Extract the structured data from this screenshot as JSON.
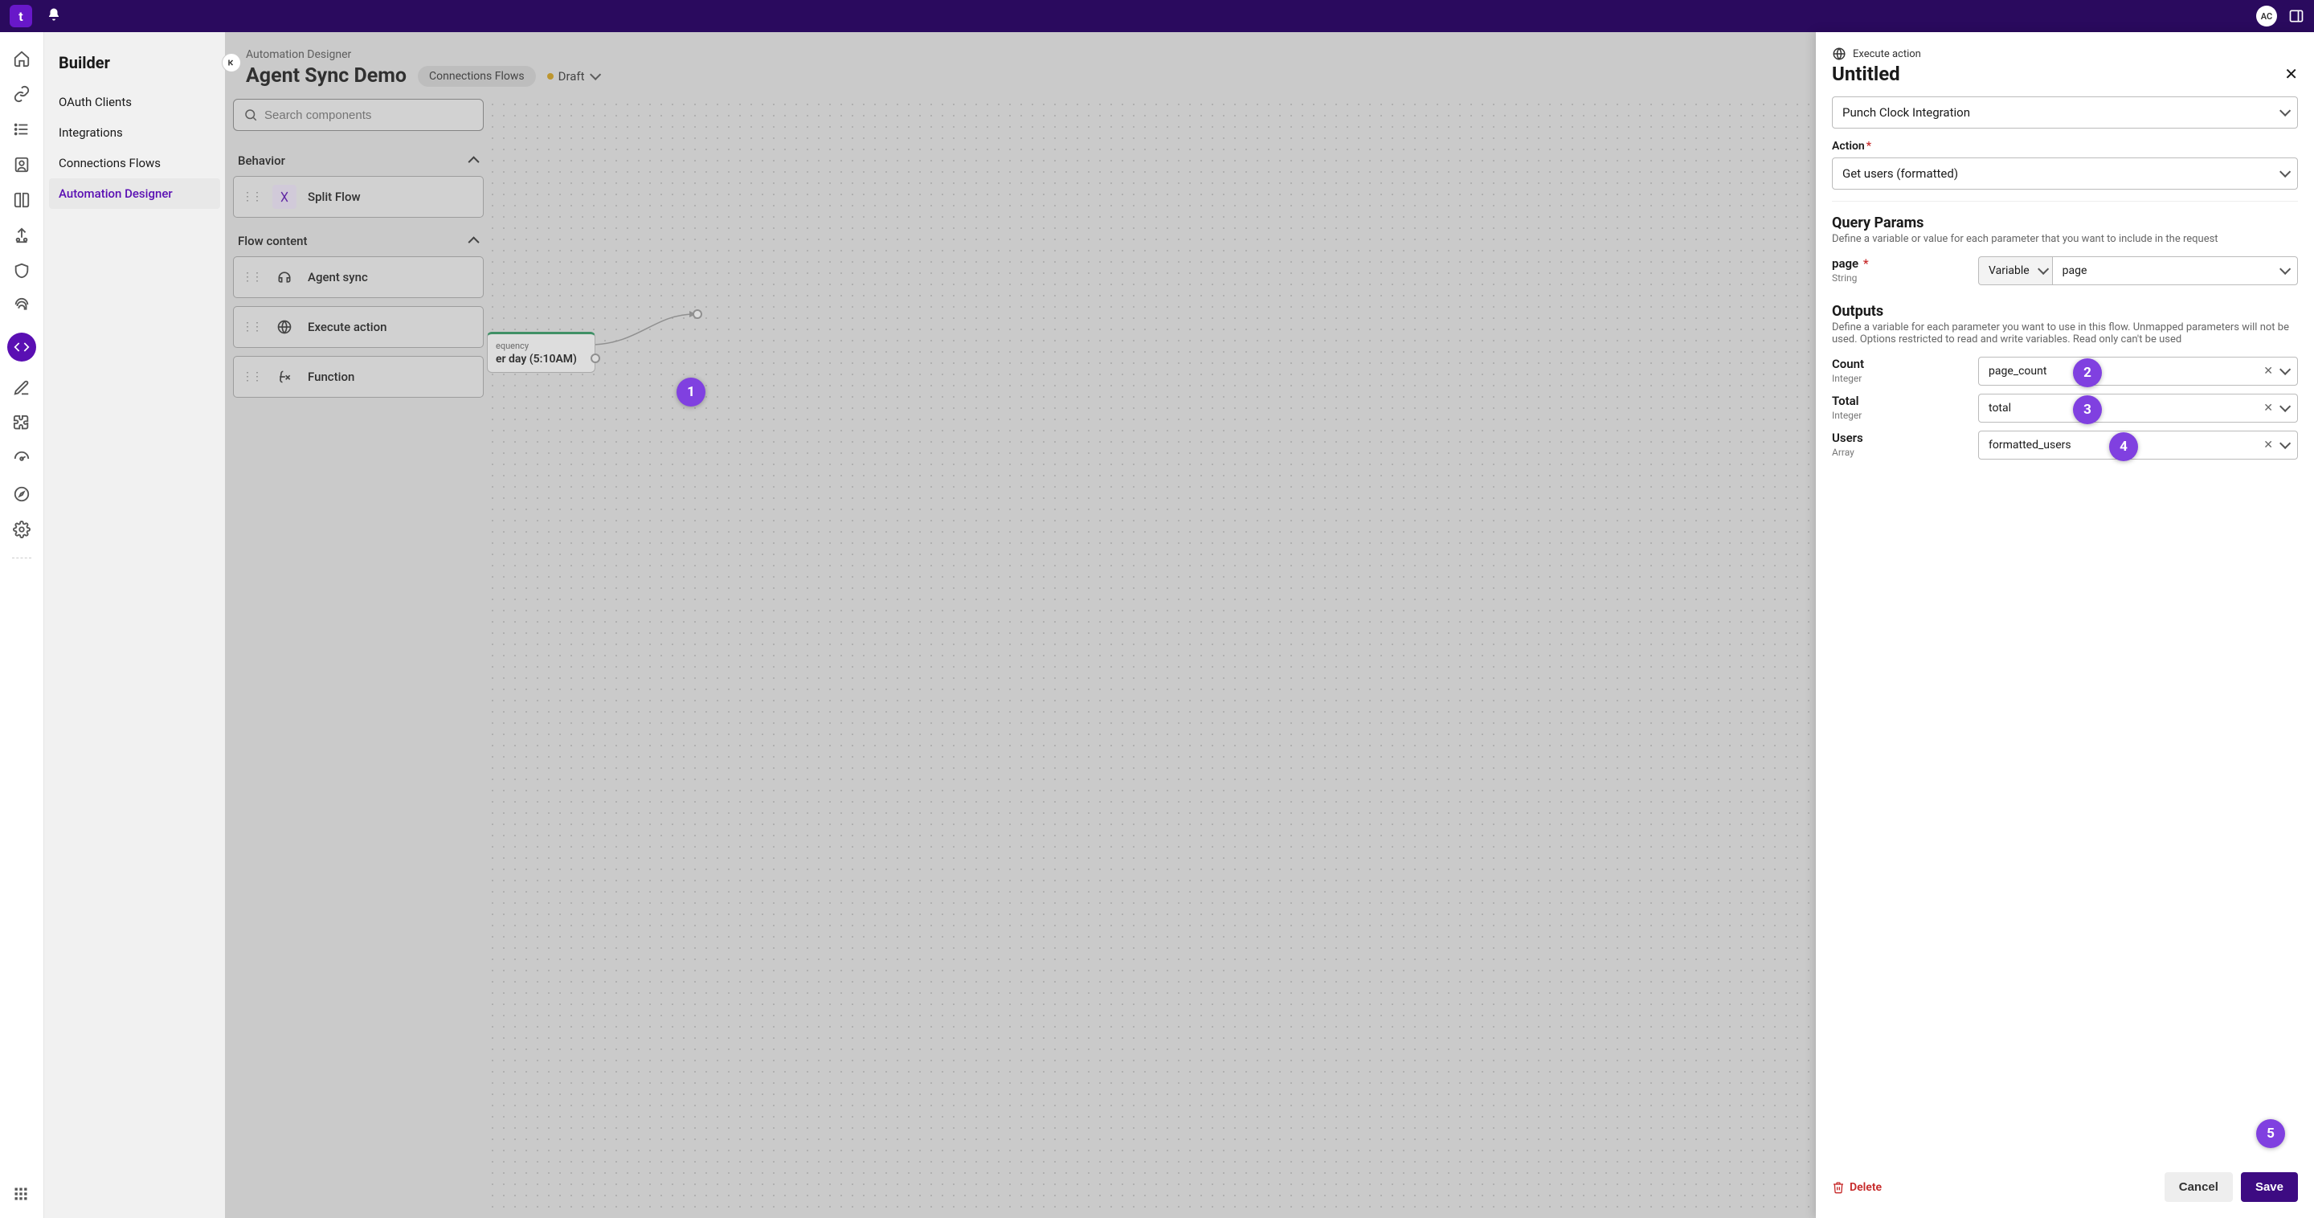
{
  "topbar": {
    "logo_char": "t",
    "avatar": "AC"
  },
  "sidebar": {
    "title": "Builder",
    "items": [
      {
        "label": "OAuth Clients"
      },
      {
        "label": "Integrations"
      },
      {
        "label": "Connections Flows"
      },
      {
        "label": "Automation Designer"
      }
    ]
  },
  "canvas": {
    "breadcrumb": "Automation Designer",
    "title": "Agent Sync Demo",
    "badge": "Connections Flows",
    "status": "Draft",
    "search_placeholder": "Search components",
    "section_behavior": "Behavior",
    "section_flow": "Flow content",
    "components": {
      "split": "Split Flow",
      "agent_sync": "Agent sync",
      "execute": "Execute action",
      "function": "Function"
    },
    "node": {
      "top": "equency",
      "main": "er day (5:10AM)"
    }
  },
  "panel": {
    "icon_label": "Execute action",
    "title": "Untitled",
    "connection_value": "Punch Clock Integration",
    "action_label": "Action",
    "action_value": "Get users (formatted)",
    "query": {
      "title": "Query Params",
      "desc": "Define a variable or value for each parameter that you want to include in the request",
      "param_name": "page",
      "param_type": "String",
      "mode": "Variable",
      "value": "page"
    },
    "outputs": {
      "title": "Outputs",
      "desc": "Define a variable for each parameter you want to use in this flow. Unmapped parameters will not be used. Options restricted to read and write variables. Read only can't be used",
      "rows": [
        {
          "name": "Count",
          "type": "Integer",
          "value": "page_count"
        },
        {
          "name": "Total",
          "type": "Integer",
          "value": "total"
        },
        {
          "name": "Users",
          "type": "Array",
          "value": "formatted_users"
        }
      ]
    },
    "delete": "Delete",
    "cancel": "Cancel",
    "save": "Save"
  },
  "annotations": {
    "n1": "1",
    "n2": "2",
    "n3": "3",
    "n4": "4",
    "n5": "5"
  }
}
